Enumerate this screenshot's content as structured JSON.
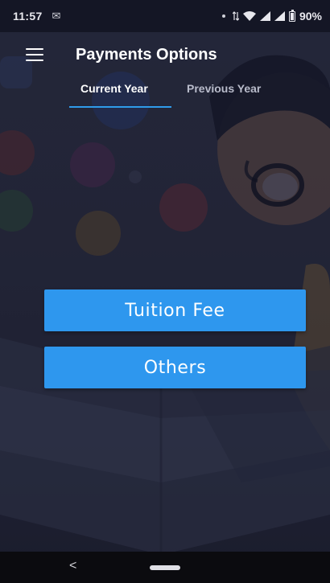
{
  "status_bar": {
    "time": "11:57",
    "message_icon": "gmail-icon",
    "battery": "90%"
  },
  "app_bar": {
    "title": "Payments Options",
    "menu_icon": "hamburger-menu-icon"
  },
  "tabs": [
    {
      "label": "Current Year",
      "selected": true
    },
    {
      "label": "Previous Year",
      "selected": false
    }
  ],
  "buttons": {
    "tuition": "Tuition Fee",
    "others": "Others"
  },
  "nav": {
    "back_glyph": "<"
  },
  "colors": {
    "accent": "#2e97ee",
    "tab_indicator": "#2f9bea",
    "background": "#2a2c40"
  }
}
